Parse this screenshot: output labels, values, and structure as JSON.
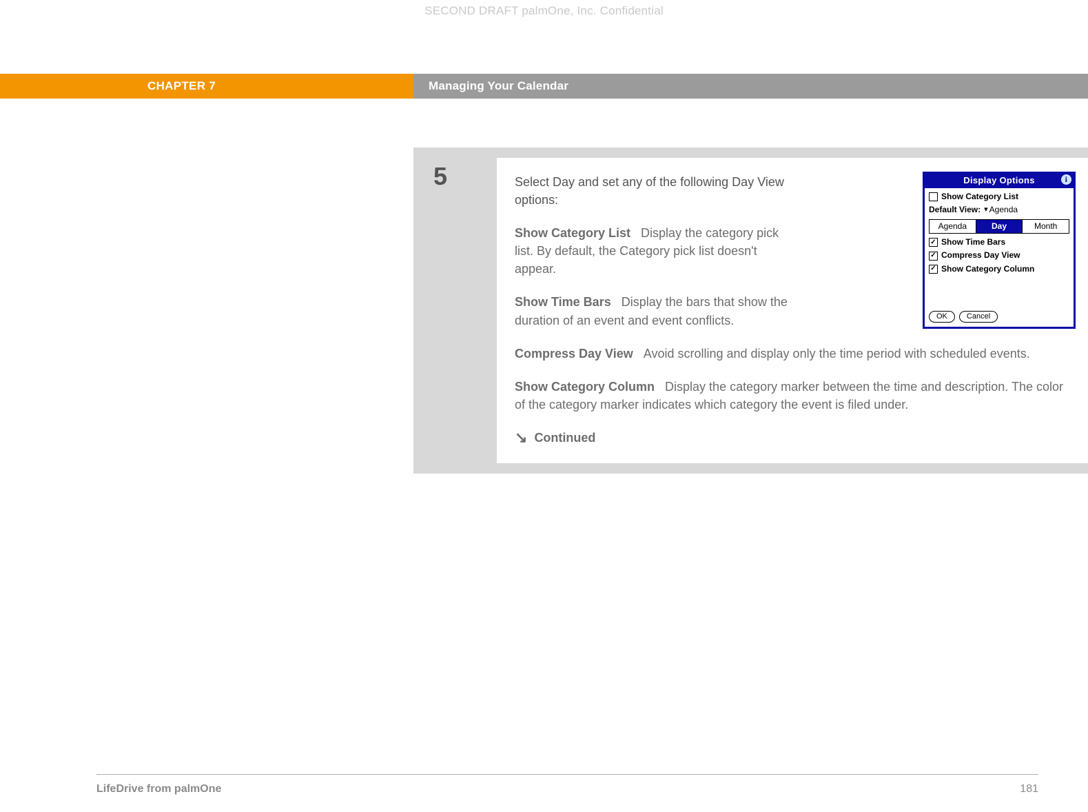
{
  "watermark": "SECOND DRAFT palmOne, Inc.  Confidential",
  "header": {
    "chapter": "CHAPTER 7",
    "section": "Managing Your Calendar"
  },
  "step": {
    "number": "5",
    "intro": "Select Day and set any of the following Day View options:",
    "options": [
      {
        "title": "Show Category List",
        "desc": "Display the category pick list. By default, the Category pick list doesn't appear."
      },
      {
        "title": "Show Time Bars",
        "desc": "Display the bars that show the duration of an event and event conflicts."
      },
      {
        "title": "Compress Day View",
        "desc": "Avoid scrolling and display only the time period with scheduled events."
      },
      {
        "title": "Show Category Column",
        "desc": "Display the category marker between the time and description. The color of the category marker indicates which category the event is filed under."
      }
    ],
    "continued": "Continued"
  },
  "screenshot": {
    "title": "Display Options",
    "show_category_list": "Show Category List",
    "default_view_label": "Default View:",
    "default_view_value": "Agenda",
    "tabs": {
      "agenda": "Agenda",
      "day": "Day",
      "month": "Month"
    },
    "show_time_bars": "Show Time Bars",
    "compress_day_view": "Compress Day View",
    "show_category_column": "Show Category Column",
    "ok": "OK",
    "cancel": "Cancel"
  },
  "footer": {
    "product": "LifeDrive from palmOne",
    "page": "181"
  }
}
